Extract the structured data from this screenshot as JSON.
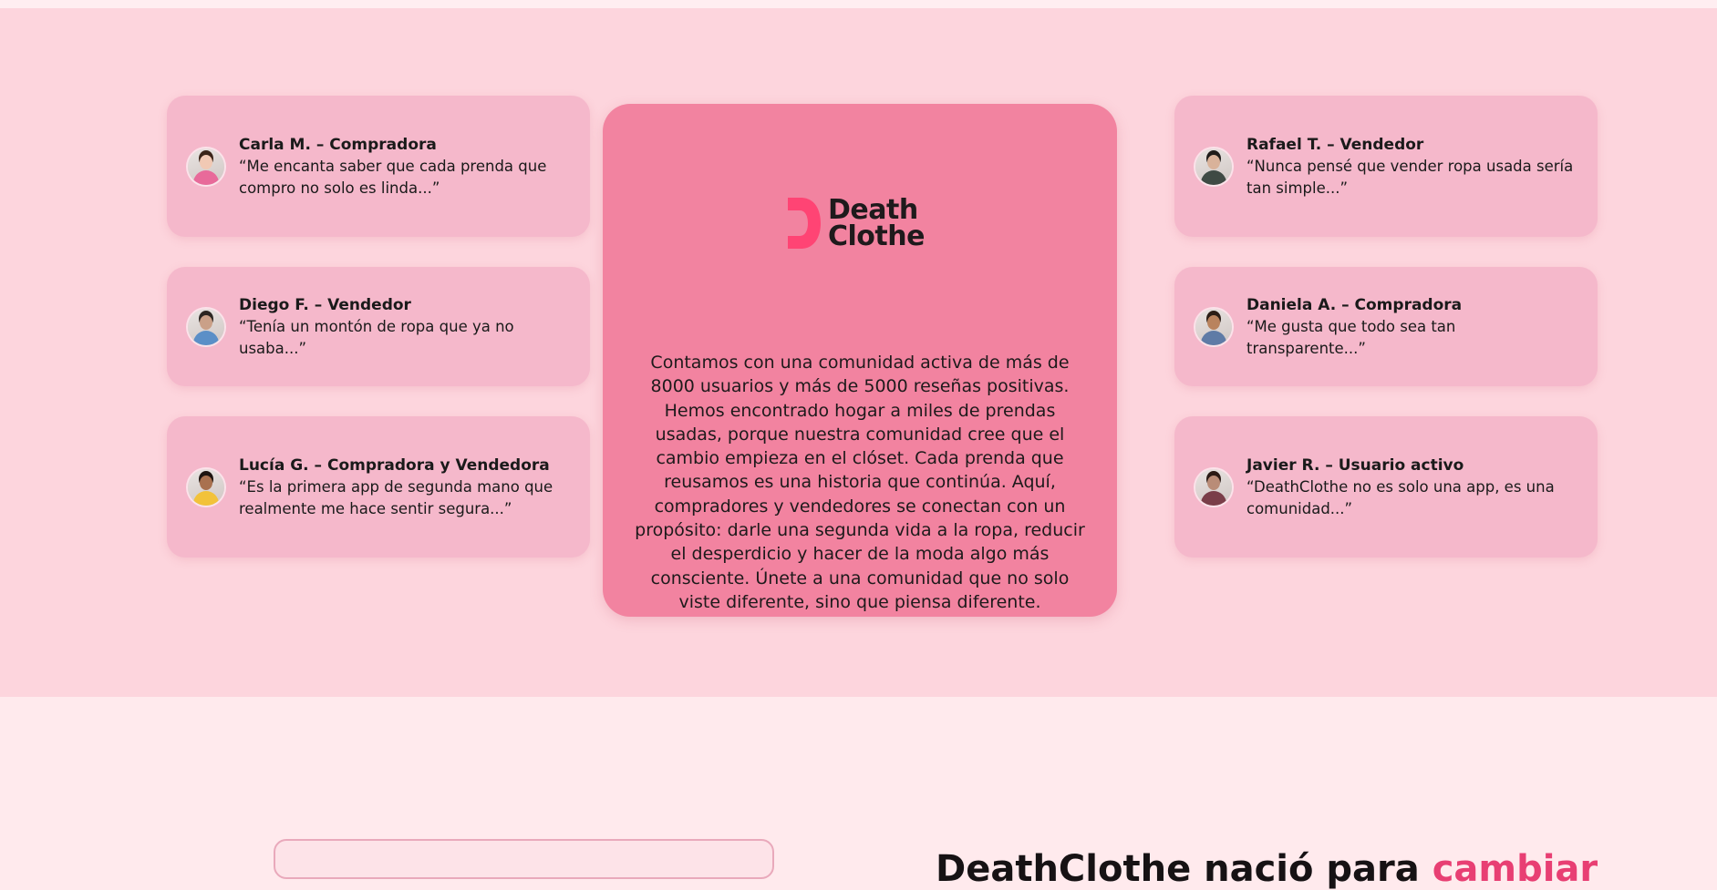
{
  "testimonials_left": [
    {
      "name": "Carla M. – Compradora",
      "quote": "“Me encanta saber que cada prenda que compro no solo es linda...”",
      "skin": "#f1c9b4",
      "shirt": "#e86a9a",
      "hair": "#3a2418"
    },
    {
      "name": "Diego F. – Vendedor",
      "quote": "“Tenía un montón de ropa que ya no usaba...”",
      "skin": "#caa088",
      "shirt": "#5b8fc7",
      "hair": "#2c2622"
    },
    {
      "name": "Lucía G. – Compradora y Vendedora",
      "quote": "“Es la primera app de segunda mano que realmente me hace sentir segura...”",
      "skin": "#a9714f",
      "shirt": "#f2c23a",
      "hair": "#1d1410"
    }
  ],
  "testimonials_right": [
    {
      "name": "Rafael T. – Vendedor",
      "quote": "“Nunca pensé que vender ropa usada sería tan simple...”",
      "skin": "#d9b29a",
      "shirt": "#3f4a44",
      "hair": "#1f1c1a"
    },
    {
      "name": "Daniela A. – Compradora",
      "quote": "“Me gusta que todo sea tan transparente...”",
      "skin": "#b9835e",
      "shirt": "#5f7ba6",
      "hair": "#2a1d16"
    },
    {
      "name": "Javier R. – Usuario activo",
      "quote": "“DeathClothe no es solo una app, es una comunidad...”",
      "skin": "#b98c77",
      "shirt": "#7a3e49",
      "hair": "#2a1a15"
    }
  ],
  "brand": {
    "line1": "Death",
    "line2": "Clothe",
    "accent_color": "#ff4474"
  },
  "community_text": "Contamos con una comunidad activa de más de 8000 usuarios y más de 5000 reseñas positivas. Hemos encontrado hogar a miles de prendas usadas, porque nuestra comunidad cree que el cambio empieza en el clóset. Cada prenda que reusamos es una historia que continúa. Aquí, compradores y vendedores se conectan con un propósito: darle una segunda vida a la ropa, reducir el desperdicio y hacer de la moda algo más consciente. Únete a una comunidad que no solo viste diferente, sino que piensa diferente.",
  "next_section": {
    "title_main": "DeathClothe nació para ",
    "title_accent": "cambiar"
  },
  "colors": {
    "card": "#f5b8cb",
    "center_card": "#f283a0",
    "section_bg": "#fdd5dd",
    "page_bg": "#ffeaed"
  }
}
